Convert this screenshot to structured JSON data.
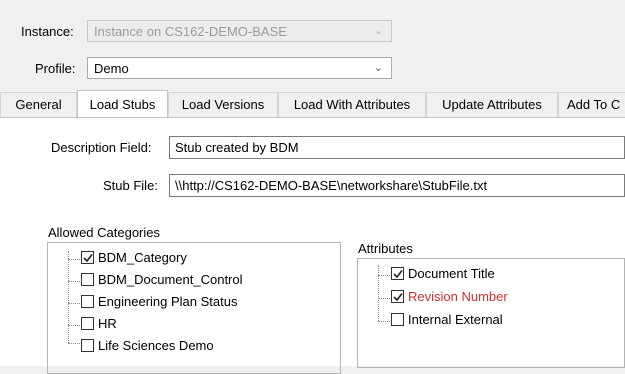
{
  "header": {
    "instance_label": "Instance:",
    "instance_value": "Instance on CS162-DEMO-BASE",
    "profile_label": "Profile:",
    "profile_value": "Demo"
  },
  "tabs": [
    {
      "label": "General",
      "active": false
    },
    {
      "label": "Load Stubs",
      "active": true
    },
    {
      "label": "Load Versions",
      "active": false
    },
    {
      "label": "Load With Attributes",
      "active": false
    },
    {
      "label": "Update Attributes",
      "active": false
    },
    {
      "label": "Add To C",
      "active": false
    }
  ],
  "form": {
    "description_label": "Description Field:",
    "description_value": "Stub created by BDM",
    "stub_file_label": "Stub File:",
    "stub_file_value": "\\\\http://CS162-DEMO-BASE\\networkshare\\StubFile.txt"
  },
  "allowed_categories": {
    "title": "Allowed Categories",
    "items": [
      {
        "label": "BDM_Category",
        "checked": true
      },
      {
        "label": "BDM_Document_Control",
        "checked": false
      },
      {
        "label": "Engineering Plan Status",
        "checked": false
      },
      {
        "label": "HR",
        "checked": false
      },
      {
        "label": "Life Sciences Demo",
        "checked": false
      }
    ]
  },
  "attributes": {
    "title": "Attributes",
    "items": [
      {
        "label": "Document Title",
        "checked": true,
        "color": "#000000"
      },
      {
        "label": "Revision Number",
        "checked": true,
        "color": "#d03030"
      },
      {
        "label": "Internal External",
        "checked": false,
        "color": "#000000"
      }
    ]
  },
  "icons": {
    "dropdown": "chevron-down-icon",
    "check": "checkmark-icon"
  }
}
